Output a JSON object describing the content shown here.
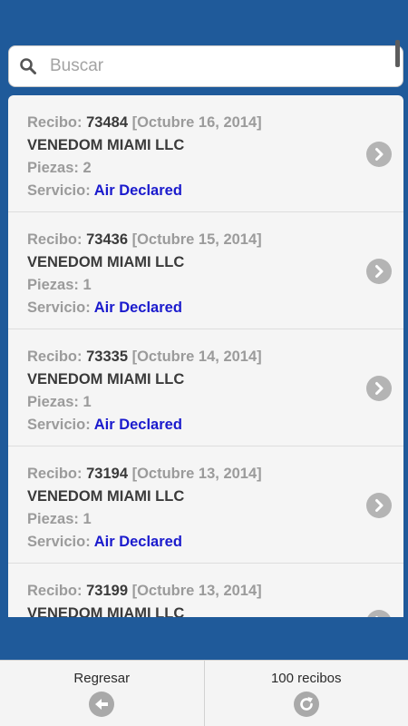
{
  "search": {
    "placeholder": "Buscar"
  },
  "receipts": [
    {
      "label": "Recibo:",
      "number": "73484",
      "date": "[Octubre 16, 2014]",
      "company": "VENEDOM MIAMI LLC",
      "pieces_label": "Piezas:",
      "pieces": "2",
      "service_label": "Servicio:",
      "service": "Air Declared"
    },
    {
      "label": "Recibo:",
      "number": "73436",
      "date": "[Octubre 15, 2014]",
      "company": "VENEDOM MIAMI LLC",
      "pieces_label": "Piezas:",
      "pieces": "1",
      "service_label": "Servicio:",
      "service": "Air Declared"
    },
    {
      "label": "Recibo:",
      "number": "73335",
      "date": "[Octubre 14, 2014]",
      "company": "VENEDOM MIAMI LLC",
      "pieces_label": "Piezas:",
      "pieces": "1",
      "service_label": "Servicio:",
      "service": "Air Declared"
    },
    {
      "label": "Recibo:",
      "number": "73194",
      "date": "[Octubre 13, 2014]",
      "company": "VENEDOM MIAMI LLC",
      "pieces_label": "Piezas:",
      "pieces": "1",
      "service_label": "Servicio:",
      "service": "Air Declared"
    },
    {
      "label": "Recibo:",
      "number": "73199",
      "date": "[Octubre 13, 2014]",
      "company": "VENEDOM MIAMI LLC"
    }
  ],
  "bottom": {
    "back_label": "Regresar",
    "back_icon": "arrow-left-icon",
    "count_label": "100 recibos",
    "count_icon": "refresh-icon"
  },
  "colors": {
    "header_bg": "#1f5a9a",
    "service": "#1a1acd",
    "icon_gray": "#b4b4b4"
  }
}
